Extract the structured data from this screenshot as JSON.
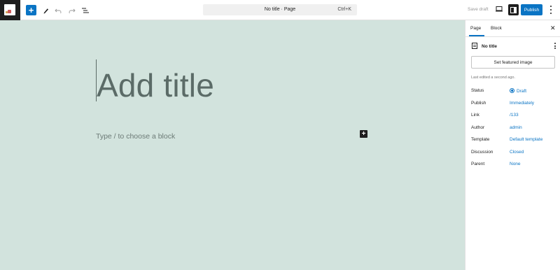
{
  "toolbar": {
    "inserter_icon": "plus-icon",
    "tool_icons": [
      "pencil-icon",
      "undo-icon",
      "redo-icon",
      "list-view-icon"
    ],
    "document_title": "No title · Page",
    "command_shortcut": "Ctrl+K",
    "save_draft_label": "Save draft",
    "publish_label": "Publish",
    "accent_color": "#0a74c4"
  },
  "editor": {
    "title_placeholder": "Add title",
    "block_placeholder": "Type / to choose a block",
    "canvas_background": "#d2e3dd"
  },
  "sidebar": {
    "tabs": [
      {
        "label": "Page",
        "active": true
      },
      {
        "label": "Block",
        "active": false
      }
    ],
    "post_title": "No title",
    "featured_image_label": "Set featured image",
    "last_edited": "Last edited a second ago.",
    "meta": [
      {
        "label": "Status",
        "value": "Draft"
      },
      {
        "label": "Publish",
        "value": "Immediately"
      },
      {
        "label": "Link",
        "value": "/133"
      },
      {
        "label": "Author",
        "value": "admin"
      },
      {
        "label": "Template",
        "value": "Default template"
      },
      {
        "label": "Discussion",
        "value": "Closed"
      },
      {
        "label": "Parent",
        "value": "None"
      }
    ]
  }
}
